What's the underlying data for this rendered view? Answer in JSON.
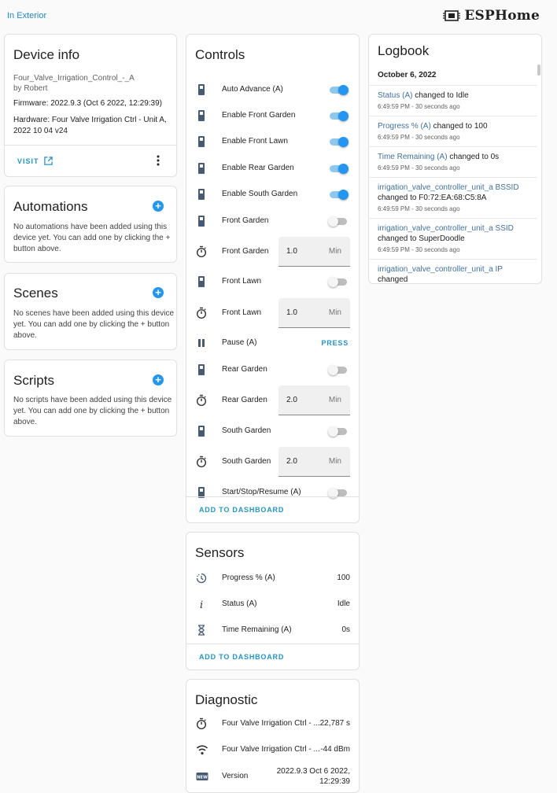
{
  "breadcrumb": "In Exterior",
  "brand": {
    "name": "ESPHome"
  },
  "device_info": {
    "title": "Device info",
    "name": "Four_Valve_Irrigation_Control_-_A",
    "by": "by Robert",
    "firmware": "Firmware: 2022.9.3 (Oct 6 2022, 12:29:39)",
    "hardware": "Hardware: Four Valve Irrigation Ctrl - Unit A, 2022 10 04 v24",
    "visit_label": "VISIT"
  },
  "automations": {
    "title": "Automations",
    "empty": "No automations have been added using this device yet. You can add one by clicking the + button above."
  },
  "scenes": {
    "title": "Scenes",
    "empty": "No scenes have been added using this device yet. You can add one by clicking the + button above."
  },
  "scripts": {
    "title": "Scripts",
    "empty": "No scripts have been added using this device yet. You can add one by clicking the + button above."
  },
  "controls": {
    "title": "Controls",
    "rows": [
      {
        "label": "Auto Advance (A)",
        "kind": "switch",
        "on": true,
        "icon": "switch-icon"
      },
      {
        "label": "Enable Front Garden",
        "kind": "switch",
        "on": true,
        "icon": "switch-icon"
      },
      {
        "label": "Enable Front Lawn",
        "kind": "switch",
        "on": true,
        "icon": "switch-icon"
      },
      {
        "label": "Enable Rear Garden",
        "kind": "switch",
        "on": true,
        "icon": "switch-icon"
      },
      {
        "label": "Enable South Garden",
        "kind": "switch",
        "on": true,
        "icon": "switch-icon"
      },
      {
        "label": "Front Garden",
        "kind": "switch",
        "on": false,
        "icon": "switch-icon"
      },
      {
        "label": "Front Garden",
        "kind": "number",
        "value": "1.0",
        "unit": "Min",
        "icon": "timer-icon"
      },
      {
        "label": "Front Lawn",
        "kind": "switch",
        "on": false,
        "icon": "switch-icon"
      },
      {
        "label": "Front Lawn",
        "kind": "number",
        "value": "1.0",
        "unit": "Min",
        "icon": "timer-icon"
      },
      {
        "label": "Pause (A)",
        "kind": "button",
        "action": "PRESS",
        "icon": "pause-icon"
      },
      {
        "label": "Rear Garden",
        "kind": "switch",
        "on": false,
        "icon": "switch-icon"
      },
      {
        "label": "Rear Garden",
        "kind": "number",
        "value": "2.0",
        "unit": "Min",
        "icon": "timer-icon"
      },
      {
        "label": "South Garden",
        "kind": "switch",
        "on": false,
        "icon": "switch-icon"
      },
      {
        "label": "South Garden",
        "kind": "number",
        "value": "2.0",
        "unit": "Min",
        "icon": "timer-icon"
      },
      {
        "label": "Start/Stop/Resume (A)",
        "kind": "switch",
        "on": false,
        "icon": "switch-icon"
      }
    ],
    "add_label": "ADD TO DASHBOARD"
  },
  "sensors": {
    "title": "Sensors",
    "rows": [
      {
        "label": "Progress % (A)",
        "value": "100",
        "icon": "progress-clock-icon"
      },
      {
        "label": "Status (A)",
        "value": "Idle",
        "icon": "info-icon"
      },
      {
        "label": "Time Remaining (A)",
        "value": "0s",
        "icon": "hourglass-icon"
      }
    ],
    "add_label": "ADD TO DASHBOARD"
  },
  "diagnostic": {
    "title": "Diagnostic",
    "rows": [
      {
        "label": "Four Valve Irrigation Ctrl - ...",
        "value": "22,787 s",
        "icon": "timer-icon"
      },
      {
        "label": "Four Valve Irrigation Ctrl - ...",
        "value": "-44 dBm",
        "icon": "wifi-icon"
      },
      {
        "label": "Version",
        "value": "2022.9.3 Oct 6 2022, 12:29:39",
        "value_line1": "2022.9.3 Oct 6 2022,",
        "value_line2": "12:29:39",
        "icon": "new-badge-icon"
      }
    ]
  },
  "logbook": {
    "title": "Logbook",
    "date": "October 6, 2022",
    "entries": [
      {
        "entity": "Status (A)",
        "message": " changed to Idle",
        "time": "6:49:59 PM - 30 seconds ago"
      },
      {
        "entity": "Progress % (A)",
        "message": " changed to 100",
        "time": "6:49:59 PM - 30 seconds ago"
      },
      {
        "entity": "Time Remaining (A)",
        "message": " changed to 0s",
        "time": "6:49:59 PM - 30 seconds ago"
      },
      {
        "entity": "irrigation_valve_controller_unit_a BSSID",
        "message": " changed to F0:72:EA:68:C5:8A",
        "time": "6:49:59 PM - 30 seconds ago"
      },
      {
        "entity": "irrigation_valve_controller_unit_a SSID",
        "message": " changed to SuperDoodle",
        "time": "6:49:59 PM - 30 seconds ago"
      },
      {
        "entity": "irrigation_valve_controller_unit_a IP",
        "message": " changed",
        "time": ""
      }
    ]
  },
  "colors": {
    "accent": "#2196f3",
    "link": "#2196c8",
    "entity": "#40719e",
    "icon": "#455a74"
  }
}
